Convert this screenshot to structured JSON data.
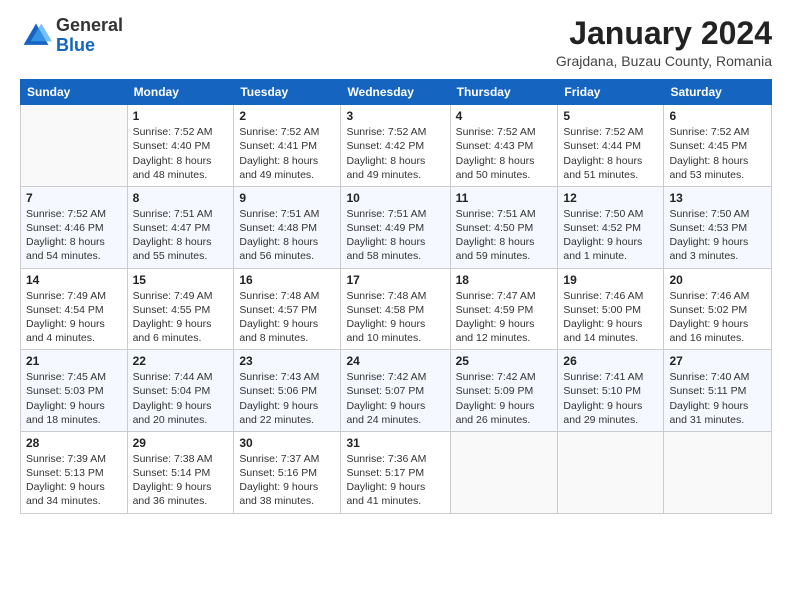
{
  "header": {
    "logo_general": "General",
    "logo_blue": "Blue",
    "main_title": "January 2024",
    "subtitle": "Grajdana, Buzau County, Romania"
  },
  "weekdays": [
    "Sunday",
    "Monday",
    "Tuesday",
    "Wednesday",
    "Thursday",
    "Friday",
    "Saturday"
  ],
  "weeks": [
    [
      {
        "day": "",
        "sunrise": "",
        "sunset": "",
        "daylight": ""
      },
      {
        "day": "1",
        "sunrise": "Sunrise: 7:52 AM",
        "sunset": "Sunset: 4:40 PM",
        "daylight": "Daylight: 8 hours and 48 minutes."
      },
      {
        "day": "2",
        "sunrise": "Sunrise: 7:52 AM",
        "sunset": "Sunset: 4:41 PM",
        "daylight": "Daylight: 8 hours and 49 minutes."
      },
      {
        "day": "3",
        "sunrise": "Sunrise: 7:52 AM",
        "sunset": "Sunset: 4:42 PM",
        "daylight": "Daylight: 8 hours and 49 minutes."
      },
      {
        "day": "4",
        "sunrise": "Sunrise: 7:52 AM",
        "sunset": "Sunset: 4:43 PM",
        "daylight": "Daylight: 8 hours and 50 minutes."
      },
      {
        "day": "5",
        "sunrise": "Sunrise: 7:52 AM",
        "sunset": "Sunset: 4:44 PM",
        "daylight": "Daylight: 8 hours and 51 minutes."
      },
      {
        "day": "6",
        "sunrise": "Sunrise: 7:52 AM",
        "sunset": "Sunset: 4:45 PM",
        "daylight": "Daylight: 8 hours and 53 minutes."
      }
    ],
    [
      {
        "day": "7",
        "sunrise": "Sunrise: 7:52 AM",
        "sunset": "Sunset: 4:46 PM",
        "daylight": "Daylight: 8 hours and 54 minutes."
      },
      {
        "day": "8",
        "sunrise": "Sunrise: 7:51 AM",
        "sunset": "Sunset: 4:47 PM",
        "daylight": "Daylight: 8 hours and 55 minutes."
      },
      {
        "day": "9",
        "sunrise": "Sunrise: 7:51 AM",
        "sunset": "Sunset: 4:48 PM",
        "daylight": "Daylight: 8 hours and 56 minutes."
      },
      {
        "day": "10",
        "sunrise": "Sunrise: 7:51 AM",
        "sunset": "Sunset: 4:49 PM",
        "daylight": "Daylight: 8 hours and 58 minutes."
      },
      {
        "day": "11",
        "sunrise": "Sunrise: 7:51 AM",
        "sunset": "Sunset: 4:50 PM",
        "daylight": "Daylight: 8 hours and 59 minutes."
      },
      {
        "day": "12",
        "sunrise": "Sunrise: 7:50 AM",
        "sunset": "Sunset: 4:52 PM",
        "daylight": "Daylight: 9 hours and 1 minute."
      },
      {
        "day": "13",
        "sunrise": "Sunrise: 7:50 AM",
        "sunset": "Sunset: 4:53 PM",
        "daylight": "Daylight: 9 hours and 3 minutes."
      }
    ],
    [
      {
        "day": "14",
        "sunrise": "Sunrise: 7:49 AM",
        "sunset": "Sunset: 4:54 PM",
        "daylight": "Daylight: 9 hours and 4 minutes."
      },
      {
        "day": "15",
        "sunrise": "Sunrise: 7:49 AM",
        "sunset": "Sunset: 4:55 PM",
        "daylight": "Daylight: 9 hours and 6 minutes."
      },
      {
        "day": "16",
        "sunrise": "Sunrise: 7:48 AM",
        "sunset": "Sunset: 4:57 PM",
        "daylight": "Daylight: 9 hours and 8 minutes."
      },
      {
        "day": "17",
        "sunrise": "Sunrise: 7:48 AM",
        "sunset": "Sunset: 4:58 PM",
        "daylight": "Daylight: 9 hours and 10 minutes."
      },
      {
        "day": "18",
        "sunrise": "Sunrise: 7:47 AM",
        "sunset": "Sunset: 4:59 PM",
        "daylight": "Daylight: 9 hours and 12 minutes."
      },
      {
        "day": "19",
        "sunrise": "Sunrise: 7:46 AM",
        "sunset": "Sunset: 5:00 PM",
        "daylight": "Daylight: 9 hours and 14 minutes."
      },
      {
        "day": "20",
        "sunrise": "Sunrise: 7:46 AM",
        "sunset": "Sunset: 5:02 PM",
        "daylight": "Daylight: 9 hours and 16 minutes."
      }
    ],
    [
      {
        "day": "21",
        "sunrise": "Sunrise: 7:45 AM",
        "sunset": "Sunset: 5:03 PM",
        "daylight": "Daylight: 9 hours and 18 minutes."
      },
      {
        "day": "22",
        "sunrise": "Sunrise: 7:44 AM",
        "sunset": "Sunset: 5:04 PM",
        "daylight": "Daylight: 9 hours and 20 minutes."
      },
      {
        "day": "23",
        "sunrise": "Sunrise: 7:43 AM",
        "sunset": "Sunset: 5:06 PM",
        "daylight": "Daylight: 9 hours and 22 minutes."
      },
      {
        "day": "24",
        "sunrise": "Sunrise: 7:42 AM",
        "sunset": "Sunset: 5:07 PM",
        "daylight": "Daylight: 9 hours and 24 minutes."
      },
      {
        "day": "25",
        "sunrise": "Sunrise: 7:42 AM",
        "sunset": "Sunset: 5:09 PM",
        "daylight": "Daylight: 9 hours and 26 minutes."
      },
      {
        "day": "26",
        "sunrise": "Sunrise: 7:41 AM",
        "sunset": "Sunset: 5:10 PM",
        "daylight": "Daylight: 9 hours and 29 minutes."
      },
      {
        "day": "27",
        "sunrise": "Sunrise: 7:40 AM",
        "sunset": "Sunset: 5:11 PM",
        "daylight": "Daylight: 9 hours and 31 minutes."
      }
    ],
    [
      {
        "day": "28",
        "sunrise": "Sunrise: 7:39 AM",
        "sunset": "Sunset: 5:13 PM",
        "daylight": "Daylight: 9 hours and 34 minutes."
      },
      {
        "day": "29",
        "sunrise": "Sunrise: 7:38 AM",
        "sunset": "Sunset: 5:14 PM",
        "daylight": "Daylight: 9 hours and 36 minutes."
      },
      {
        "day": "30",
        "sunrise": "Sunrise: 7:37 AM",
        "sunset": "Sunset: 5:16 PM",
        "daylight": "Daylight: 9 hours and 38 minutes."
      },
      {
        "day": "31",
        "sunrise": "Sunrise: 7:36 AM",
        "sunset": "Sunset: 5:17 PM",
        "daylight": "Daylight: 9 hours and 41 minutes."
      },
      {
        "day": "",
        "sunrise": "",
        "sunset": "",
        "daylight": ""
      },
      {
        "day": "",
        "sunrise": "",
        "sunset": "",
        "daylight": ""
      },
      {
        "day": "",
        "sunrise": "",
        "sunset": "",
        "daylight": ""
      }
    ]
  ]
}
